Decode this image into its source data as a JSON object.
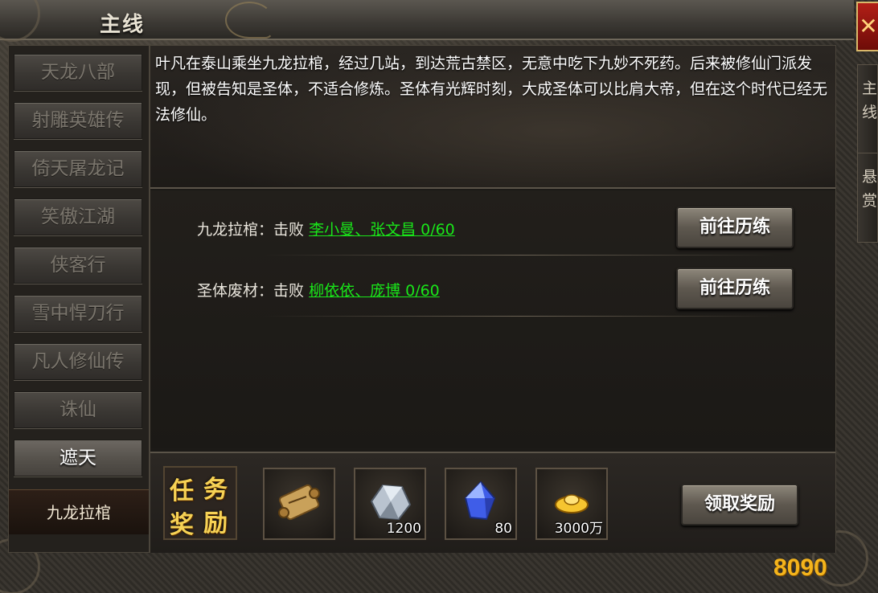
{
  "window": {
    "title": "主线",
    "close_label": "✕"
  },
  "right_tabs": [
    {
      "label": "主线"
    },
    {
      "label": "悬赏"
    }
  ],
  "nav": {
    "items": [
      {
        "label": "天龙八部"
      },
      {
        "label": "射雕英雄传"
      },
      {
        "label": "倚天屠龙记"
      },
      {
        "label": "笑傲江湖"
      },
      {
        "label": "侠客行"
      },
      {
        "label": "雪中悍刀行"
      },
      {
        "label": "凡人修仙传"
      },
      {
        "label": "诛仙"
      },
      {
        "label": "遮天"
      }
    ],
    "selected": "遮天",
    "sub_item": "九龙拉棺"
  },
  "story": {
    "text": "叶凡在泰山乘坐九龙拉棺，经过几站，到达荒古禁区，无意中吃下九妙不死药。后来被修仙门派发现，但被告知是圣体，不适合修炼。圣体有光辉时刻，大成圣体可以比肩大帝，但在这个时代已经无法修仙。"
  },
  "quests": [
    {
      "name": "九龙拉棺：击败",
      "target": "李小曼、张文昌 0/60",
      "button": "前往历练"
    },
    {
      "name": "圣体废材：击败",
      "target": "柳依依、庞博 0/60",
      "button": "前往历练"
    }
  ],
  "rewards": {
    "title_chars": [
      "任",
      "务",
      "奖",
      "励"
    ],
    "items": [
      {
        "icon": "scroll-icon",
        "count": ""
      },
      {
        "icon": "ore-icon",
        "count": "1200"
      },
      {
        "icon": "blue-gem-icon",
        "count": "80"
      },
      {
        "icon": "gold-ingot-icon",
        "count": "3000万"
      }
    ],
    "claim_button": "领取奖励"
  },
  "watermark": "8090"
}
